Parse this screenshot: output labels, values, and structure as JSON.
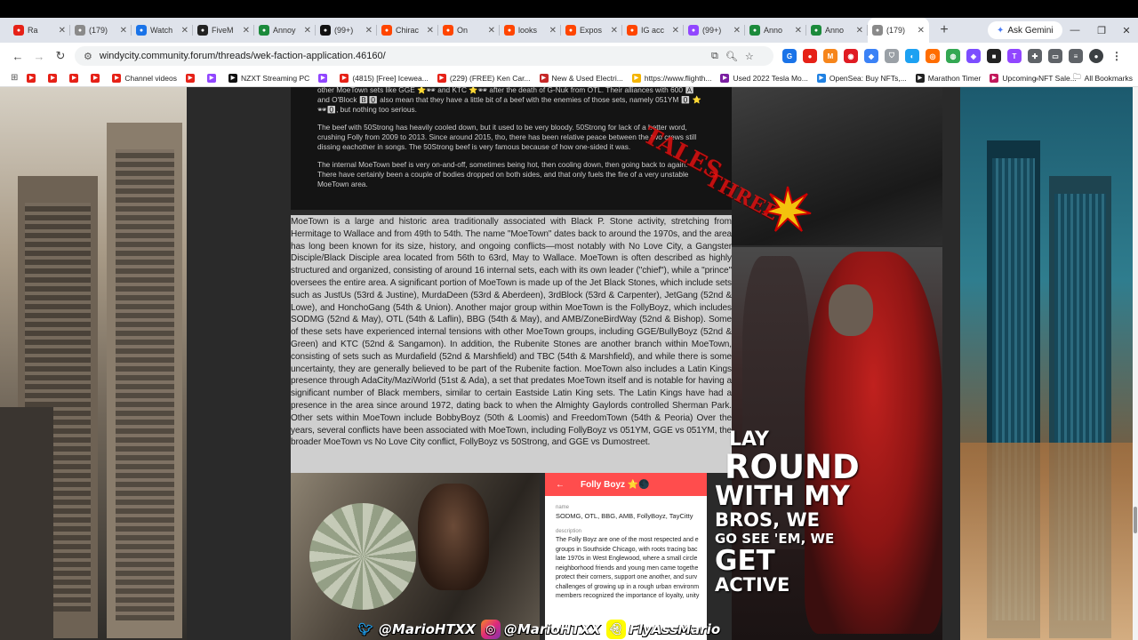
{
  "browser": {
    "tabs": [
      {
        "title": "Ra",
        "icon": "youtube-icon",
        "color": "#e62117"
      },
      {
        "title": "(179)",
        "icon": "forum-icon",
        "color": "#8a8a8a"
      },
      {
        "title": "Watch",
        "icon": "watch-icon",
        "color": "#1a73e8"
      },
      {
        "title": "FiveM",
        "icon": "fivem-icon",
        "color": "#222222"
      },
      {
        "title": "Annoy",
        "icon": "annoy-icon",
        "color": "#1b8a3b"
      },
      {
        "title": "(99+)",
        "icon": "tiktok-icon",
        "color": "#111111"
      },
      {
        "title": "Chirac",
        "icon": "reddit-icon",
        "color": "#ff4500"
      },
      {
        "title": "On",
        "icon": "reddit-icon",
        "color": "#ff4500"
      },
      {
        "title": "looks",
        "icon": "reddit-icon",
        "color": "#ff4500"
      },
      {
        "title": "Expos",
        "icon": "reddit-icon",
        "color": "#ff4500"
      },
      {
        "title": "IG acc",
        "icon": "reddit-icon",
        "color": "#ff4500"
      },
      {
        "title": "(99+)",
        "icon": "twitch-icon",
        "color": "#9146ff"
      },
      {
        "title": "Anno",
        "icon": "annoy-icon",
        "color": "#1b8a3b"
      },
      {
        "title": "Anno",
        "icon": "annoy-icon",
        "color": "#1b8a3b"
      },
      {
        "title": "(179)",
        "icon": "forum-icon",
        "color": "#8a8a8a",
        "active": true
      }
    ],
    "new_tab": "+",
    "ask_gemini": "Ask Gemini",
    "url": "windycity.community.forum/threads/wek-faction-application.46160/",
    "bookmarks": [
      {
        "label": "",
        "icon": "youtube-icon"
      },
      {
        "label": "",
        "icon": "youtube-icon"
      },
      {
        "label": "",
        "icon": "youtube-icon"
      },
      {
        "label": "",
        "icon": "youtube-icon"
      },
      {
        "label": "Channel videos",
        "icon": "youtube-icon"
      },
      {
        "label": "",
        "icon": "youtube-icon"
      },
      {
        "label": "",
        "icon": "twitch-icon"
      },
      {
        "label": "NZXT Streaming PC",
        "icon": "nzxt-icon"
      },
      {
        "label": "",
        "icon": "twitch-icon"
      },
      {
        "label": "(4815) [Free] Icewea...",
        "icon": "youtube-icon"
      },
      {
        "label": "(229) (FREE) Ken Car...",
        "icon": "youtube-icon"
      },
      {
        "label": "New & Used Electri...",
        "icon": "car-icon"
      },
      {
        "label": "https://www.flighth...",
        "icon": "flight-icon"
      },
      {
        "label": "Used 2022 Tesla Mo...",
        "icon": "tesla-icon"
      },
      {
        "label": "OpenSea: Buy NFTs,...",
        "icon": "opensea-icon"
      },
      {
        "label": "Marathon Timer",
        "icon": "timer-icon"
      },
      {
        "label": "Upcoming NFT Sale...",
        "icon": "nft-icon"
      }
    ],
    "all_bookmarks": "All Bookmarks"
  },
  "forum": {
    "dark_paragraphs": [
      "other MoeTown sets like GGE ⭐🕶 and KTC ⭐🕶 after the death of G-Nuk from OTL. Their alliances with 600 🅰 and O'Block 🅱🅾 also mean that they have a little bit of a beef with the enemies of those sets, namely 051YM 🅾 ⭐🕶🅾, but nothing too serious.",
      "The beef with 50Strong has heavily cooled down, but it used to be very bloody. 50Strong for lack of a better word, crushing Folly from 2009 to 2013. Since around 2015, tho, there has been relative peace between the two crews still dissing eachother in songs. The 50Strong beef is very famous because of how one-sided it was.",
      "The internal MoeTown beef is very on-and-off, sometimes being hot, then cooling down, then going back to again. There have certainly been a couple of bodies dropped on both sides, and that only fuels the fire of a very unstable MoeTown area."
    ],
    "main_paragraph": "MoeTown is a large and historic area traditionally associated with Black P. Stone activity, stretching from Hermitage to Wallace and from 49th to 54th. The name \"MoeTown\" dates back to around the 1970s, and the area has long been known for its size, history, and ongoing conflicts—most notably with No Love City, a Gangster Disciple/Black Disciple area located from 56th to 63rd, May to Wallace. MoeTown is often described as highly structured and organized, consisting of around 16 internal sets, each with its own leader (\"chief\"), while a \"prince\" oversees the entire area. A significant portion of MoeTown is made up of the Jet Black Stones, which include sets such as JustUs (53rd & Justine), MurdaDeen (53rd & Aberdeen), 3rdBlock (53rd & Carpenter), JetGang (52nd & Lowe), and HonchoGang (54th & Union). Another major group within MoeTown is the FollyBoyz, which includes SODMG (52nd & May), OTL (54th & Laflin), BBG (54th & May), and AMB/ZoneBirdWay (52nd & Bishop). Some of these sets have experienced internal tensions with other MoeTown groups, including GGE/BullyBoyz (52nd & Green) and KTC (52nd & Sangamon). In addition, the Rubenite Stones are another branch within MoeTown, consisting of sets such as Murdafield (52nd & Marshfield) and TBC (54th & Marshfield), and while there is some uncertainty, they are generally believed to be part of the Rubenite faction. MoeTown also includes a Latin Kings presence through AdaCity/MaziWorld (51st & Ada), a set that predates MoeTown itself and is notable for having a significant number of Black members, similar to certain Eastside Latin King sets. The Latin Kings have had a presence in the area since around 1972, dating back to when the Almighty Gaylords controlled Sherman Park. Other sets within MoeTown include BobbyBoyz (50th & Loomis) and FreedomTown (54th & Peoria) Over the years, several conflicts have been associated with MoeTown, including FollyBoyz vs 051YM, GGE vs 051YM, the broader MoeTown vs No Love City conflict, FollyBoyz vs 50Strong, and GGE vs Dumostreet.",
    "card": {
      "title": "Folly Boyz ⭐🌑",
      "name_label": "name",
      "name_value": "SODMG, OTL, BBG, AMB, FollyBoyz, TayCitty",
      "desc_label": "description",
      "desc_value": "The Folly Boyz are one of the most respected and e groups in Southside Chicago, with roots tracing bac late 1970s in West Englewood, where a small circle neighborhood friends and young men came togethe protect their corners, support one another, and surv challenges of growing up in a rough urban environm members recognized the importance of loyalty, unity"
    }
  },
  "overlay": {
    "lyrics": [
      "LAY",
      "ROUND",
      "WITH MY",
      "BROS, WE",
      "GO SEE 'EM, WE",
      "GET",
      "ACTIVE"
    ],
    "graffiti": [
      "TALES",
      "THREE"
    ],
    "socials": [
      {
        "handle": "@MarioHTXX",
        "icon": "twitter-icon"
      },
      {
        "handle": "@MarioHTXX",
        "icon": "instagram-icon"
      },
      {
        "handle": "FlyAssMario",
        "icon": "snapchat-icon"
      }
    ]
  },
  "colors": {
    "card_header": "#ff4d4d",
    "hoodie_red": "#c0211e",
    "graffiti_red": "#e01010"
  }
}
